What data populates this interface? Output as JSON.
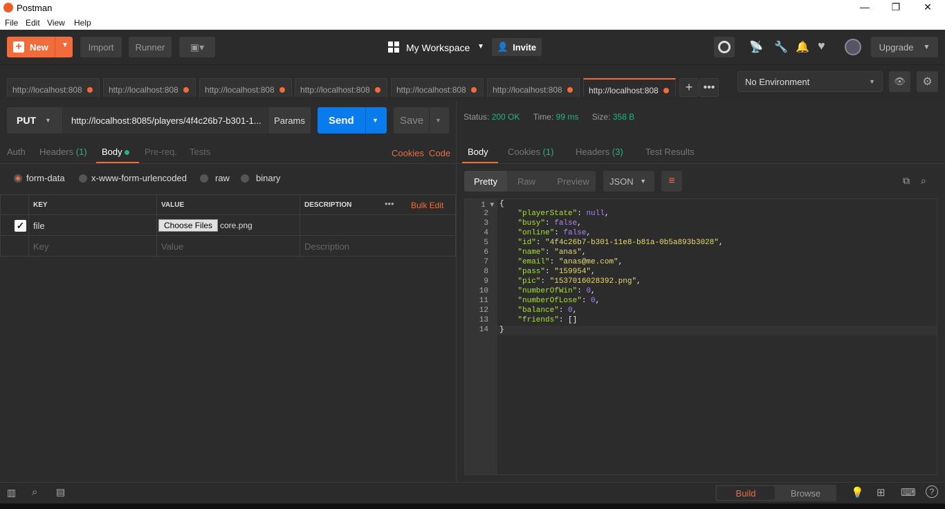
{
  "window": {
    "title": "Postman"
  },
  "menu": [
    "File",
    "Edit",
    "View",
    "Help"
  ],
  "header": {
    "new_label": "New",
    "import_label": "Import",
    "runner_label": "Runner",
    "workspace_label": "My Workspace",
    "invite_label": "Invite",
    "upgrade_label": "Upgrade"
  },
  "tabs": [
    "http://localhost:808",
    "http://localhost:808",
    "http://localhost:808",
    "http://localhost:808",
    "http://localhost:808",
    "http://localhost:808",
    "http://localhost:808"
  ],
  "environment": {
    "selected": "No Environment"
  },
  "request": {
    "method": "PUT",
    "url": "http://localhost:8085/players/4f4c26b7-b301-1...",
    "params_label": "Params",
    "send_label": "Send",
    "save_label": "Save"
  },
  "req_tabs": {
    "auth": "Auth",
    "headers": "Headers",
    "headers_count": "(1)",
    "body": "Body",
    "prereq": "Pre-req.",
    "tests": "Tests",
    "cookies": "Cookies",
    "code": "Code"
  },
  "body_types": {
    "form_data": "form-data",
    "urlencoded": "x-www-form-urlencoded",
    "raw": "raw",
    "binary": "binary"
  },
  "table": {
    "col_key": "KEY",
    "col_value": "VALUE",
    "col_desc": "DESCRIPTION",
    "bulk_edit": "Bulk Edit",
    "row_key": "file",
    "choose_files": "Choose Files",
    "file_name": "core.png",
    "key_ph": "Key",
    "value_ph": "Value",
    "desc_ph": "Description"
  },
  "response": {
    "status_label": "Status:",
    "status": "200 OK",
    "time_label": "Time:",
    "time": "99 ms",
    "size_label": "Size:",
    "size": "358 B"
  },
  "res_tabs": {
    "body": "Body",
    "cookies": "Cookies",
    "cookies_count": "(1)",
    "headers": "Headers",
    "headers_count": "(3)",
    "tests": "Test Results"
  },
  "view": {
    "pretty": "Pretty",
    "raw": "Raw",
    "preview": "Preview",
    "format": "JSON"
  },
  "code_lines": [
    "{",
    "    \"playerState\": null,",
    "    \"busy\": false,",
    "    \"online\": false,",
    "    \"id\": \"4f4c26b7-b301-11e8-b81a-0b5a893b3028\",",
    "    \"name\": \"anas\",",
    "    \"email\": \"anas@me.com\",",
    "    \"pass\": \"159954\",",
    "    \"pic\": \"1537016028392.png\",",
    "    \"numberOfWin\": 0,",
    "    \"numberOfLose\": 0,",
    "    \"balance\": 0,",
    "    \"friends\": []",
    "}"
  ],
  "statusbar": {
    "build": "Build",
    "browse": "Browse"
  },
  "colors": {
    "accent": "#f26b3a",
    "send": "#097bed",
    "green": "#26b47f",
    "json_key": "#a6e22e",
    "json_string": "#e6db74",
    "json_literal": "#ae81ff"
  }
}
